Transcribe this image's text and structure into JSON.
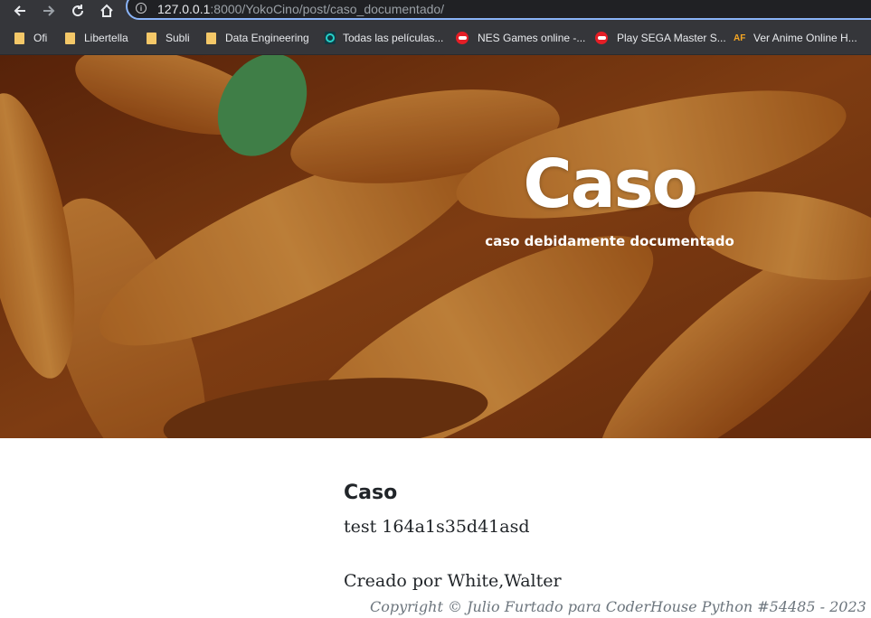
{
  "browser": {
    "url_host": "127.0.0.1",
    "url_rest": ":8000/YokoCino/post/caso_documentado/"
  },
  "bookmarks": [
    {
      "label": "Ofi",
      "icon": "folder-icon"
    },
    {
      "label": "Libertella",
      "icon": "folder-icon"
    },
    {
      "label": "Subli",
      "icon": "folder-icon"
    },
    {
      "label": "Data Engineering",
      "icon": "folder-icon"
    },
    {
      "label": "Todas las películas...",
      "icon": "site-icon"
    },
    {
      "label": "NES Games online -...",
      "icon": "game-icon"
    },
    {
      "label": "Play SEGA Master S...",
      "icon": "game-icon"
    },
    {
      "label": "Ver Anime Online H...",
      "icon": "af-icon"
    }
  ],
  "hero": {
    "title": "Caso",
    "subtitle": "caso debidamente documentado"
  },
  "post": {
    "title": "Caso",
    "body": "test 164a1s35d41asd",
    "author": "Creado por White,Walter"
  },
  "footer": {
    "copyright": "Copyright © Julio Furtado para CoderHouse Python #54485 - 2023"
  }
}
